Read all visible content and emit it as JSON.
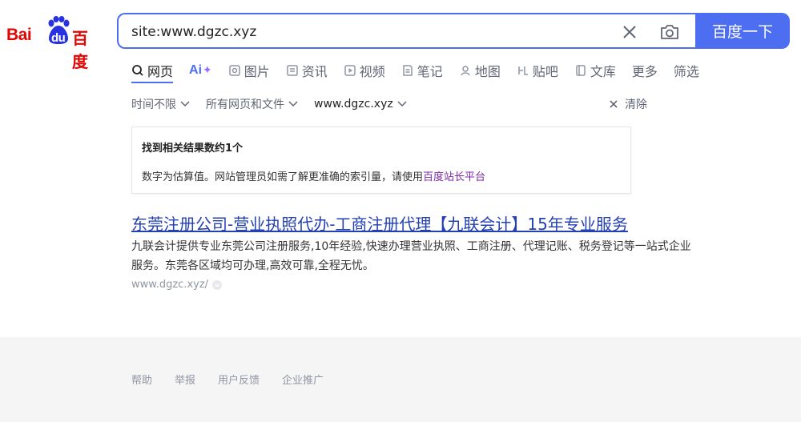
{
  "logo": {
    "text_left": "Bai",
    "text_mid": "du",
    "text_right": "百度"
  },
  "search": {
    "query": "site:www.dgzc.xyz",
    "button_label": "百度一下",
    "clear_icon": "close-icon",
    "camera_icon": "camera-icon"
  },
  "tabs": [
    {
      "label": "网页",
      "icon": "search-icon",
      "active": true
    },
    {
      "label": "Ai",
      "icon": "ai-icon"
    },
    {
      "label": "图片",
      "icon": "image-icon"
    },
    {
      "label": "资讯",
      "icon": "news-icon"
    },
    {
      "label": "视频",
      "icon": "video-icon"
    },
    {
      "label": "笔记",
      "icon": "note-icon"
    },
    {
      "label": "地图",
      "icon": "map-icon"
    },
    {
      "label": "贴吧",
      "icon": "tieba-icon"
    },
    {
      "label": "文库",
      "icon": "doc-icon"
    },
    {
      "label": "更多"
    },
    {
      "label": "筛选"
    }
  ],
  "filters": {
    "time": "时间不限",
    "type": "所有网页和文件",
    "site": "www.dgzc.xyz",
    "clear": "清除"
  },
  "info": {
    "title": "找到相关结果数约1个",
    "text": "数字为估算值。网站管理员如需了解更准确的索引量，请使用",
    "link": "百度站长平台"
  },
  "result": {
    "title": "东莞注册公司-营业执照代办-工商注册代理【九联会计】15年专业服务",
    "abstract": "九联会计提供专业东莞公司注册服务,10年经验,快速办理营业执照、工商注册、代理记账、税务登记等一站式企业服务。东莞各区域均可办理,高效可靠,全程无忧。",
    "url": "www.dgzc.xyz/"
  },
  "footer": {
    "links": [
      "帮助",
      "举报",
      "用户反馈",
      "企业推广"
    ]
  },
  "colors": {
    "brand_blue": "#4e6ef2",
    "logo_red": "#e10602",
    "logo_blue": "#2932e1",
    "link_blue": "#2440b3",
    "visited_purple": "#7a29a4"
  }
}
